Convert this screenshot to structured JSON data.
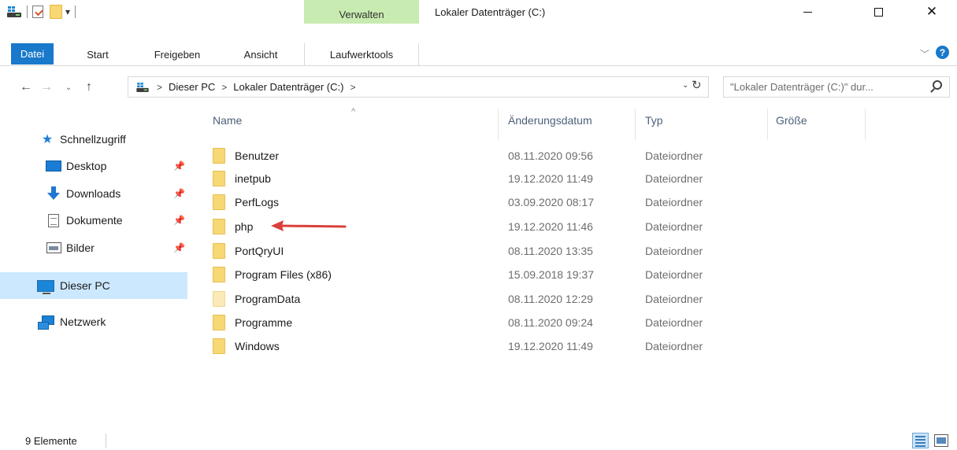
{
  "window": {
    "title": "Lokaler Datenträger (C:)",
    "context_tab_group": "Verwalten",
    "controls": {
      "minimize_icon": "minimize-icon",
      "maximize_icon": "maximize-icon",
      "close_icon": "close-icon",
      "close_glyph": "✕"
    }
  },
  "quick_access_toolbar": {
    "items": [
      "drive-icon",
      "properties-icon",
      "new-folder-icon",
      "customize-dropdown-icon"
    ],
    "dropdown_glyph": "▾"
  },
  "ribbon": {
    "tabs": [
      {
        "label": "Datei",
        "active_color": "#1979ca"
      },
      {
        "label": "Start"
      },
      {
        "label": "Freigeben"
      },
      {
        "label": "Ansicht"
      },
      {
        "label": "Laufwerktools",
        "context_color": "#c7ebb0"
      }
    ],
    "expand_glyph": "﹀",
    "help_glyph": "?"
  },
  "navigation": {
    "back_glyph": "←",
    "forward_glyph": "→",
    "recent_glyph": "⌄",
    "up_glyph": "↑",
    "breadcrumb": [
      "Dieser PC",
      "Lokaler Datenträger (C:)"
    ],
    "breadcrumb_sep": ">",
    "dropdown_glyph": "⌄",
    "refresh_glyph": "↻",
    "search_placeholder": "\"Lokaler Datenträger (C:)\" dur..."
  },
  "sidebar": {
    "quick_access_label": "Schnellzugriff",
    "pin_glyph": "📌",
    "items": [
      {
        "label": "Desktop",
        "icon": "desktop-icon",
        "pinned": true
      },
      {
        "label": "Downloads",
        "icon": "downloads-icon",
        "pinned": true
      },
      {
        "label": "Dokumente",
        "icon": "documents-icon",
        "pinned": true
      },
      {
        "label": "Bilder",
        "icon": "pictures-icon",
        "pinned": true
      }
    ],
    "this_pc_label": "Dieser PC",
    "network_label": "Netzwerk",
    "selected_color": "#cce8ff"
  },
  "file_list": {
    "sort_glyph": "^",
    "columns": [
      "Name",
      "Änderungsdatum",
      "Typ",
      "Größe"
    ],
    "rows": [
      {
        "name": "Benutzer",
        "date": "08.11.2020 09:56",
        "type": "Dateiordner"
      },
      {
        "name": "inetpub",
        "date": "19.12.2020 11:49",
        "type": "Dateiordner"
      },
      {
        "name": "PerfLogs",
        "date": "03.09.2020 08:17",
        "type": "Dateiordner"
      },
      {
        "name": "php",
        "date": "19.12.2020 11:46",
        "type": "Dateiordner",
        "highlighted_by_arrow": true
      },
      {
        "name": "PortQryUI",
        "date": "08.11.2020 13:35",
        "type": "Dateiordner"
      },
      {
        "name": "Program Files (x86)",
        "date": "15.09.2018 19:37",
        "type": "Dateiordner"
      },
      {
        "name": "ProgramData",
        "date": "08.11.2020 12:29",
        "type": "Dateiordner",
        "hidden": true
      },
      {
        "name": "Programme",
        "date": "08.11.2020 09:24",
        "type": "Dateiordner"
      },
      {
        "name": "Windows",
        "date": "19.12.2020 11:49",
        "type": "Dateiordner"
      }
    ],
    "annotation_arrow_color": "#d9403a"
  },
  "status_bar": {
    "item_count": "9 Elemente",
    "view_buttons": [
      "details-view-icon",
      "tiles-view-icon"
    ]
  }
}
